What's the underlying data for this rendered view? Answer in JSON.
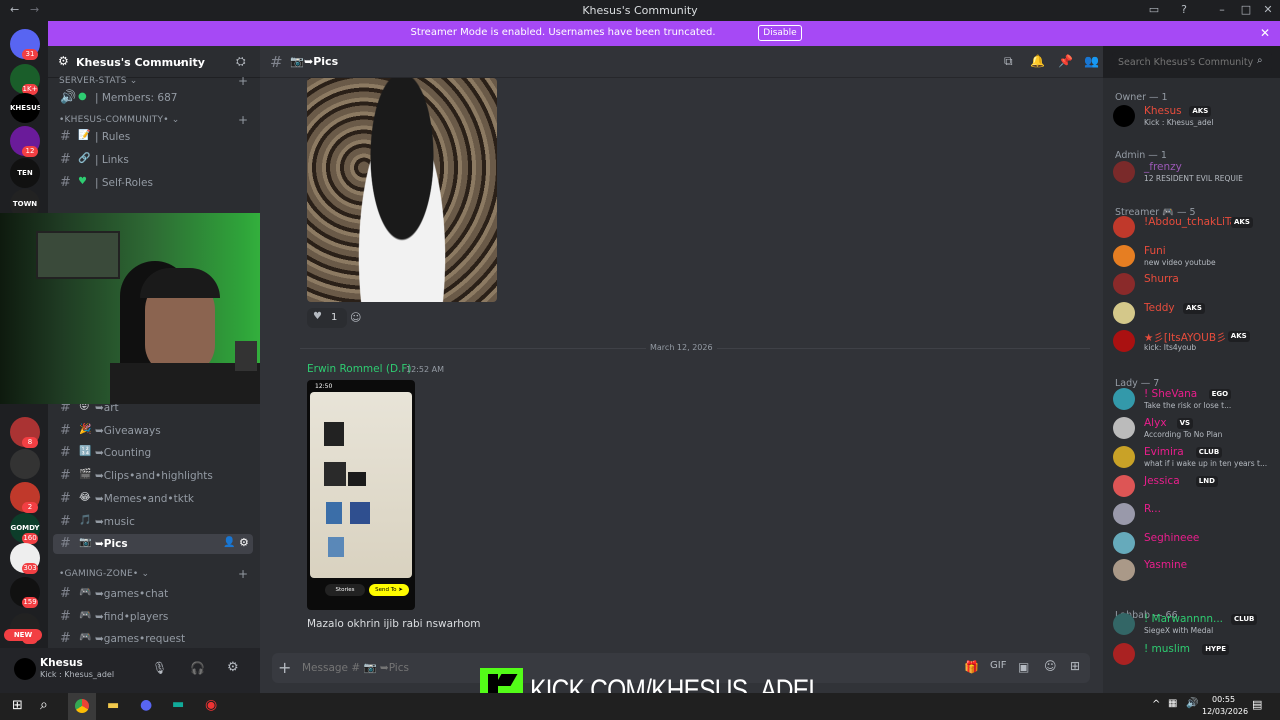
{
  "window": {
    "title": "Khesus's Community"
  },
  "banner": {
    "message": "Streamer Mode is enabled. Usernames have been truncated.",
    "disable_label": "Disable"
  },
  "server_list": [
    {
      "label": "",
      "badge": "31"
    },
    {
      "label": "",
      "badge": "1K+"
    },
    {
      "label": "KHESUS",
      "badge": ""
    },
    {
      "label": "",
      "badge": "12"
    },
    {
      "label": "TEN",
      "badge": ""
    },
    {
      "label": "TOWN",
      "badge": ""
    },
    {
      "label": "",
      "badge": "8"
    },
    {
      "label": "",
      "badge": ""
    },
    {
      "label": "",
      "badge": "2"
    },
    {
      "label": "GOMDY",
      "badge": "160"
    },
    {
      "label": "",
      "badge": "303"
    },
    {
      "label": "",
      "badge": "159"
    },
    {
      "label": "",
      "badge": "224"
    }
  ],
  "new_badge": "NEW",
  "sidebar": {
    "server_name": "Khesus's Community",
    "categories": [
      {
        "name": "SERVER-STATS ⌄",
        "channels": [
          {
            "label": "| Members: 687",
            "icon": "speaker-icon"
          }
        ]
      },
      {
        "name": "•KHESUS-COMMUNITY• ⌄",
        "channels": [
          {
            "label": "| Rules",
            "icon": "rules-icon"
          },
          {
            "label": "| Links",
            "icon": "link-icon"
          },
          {
            "label": "| Self-Roles",
            "icon": "heart-icon"
          }
        ]
      }
    ],
    "channels_lower": [
      {
        "label": "➥art"
      },
      {
        "label": "➥Giveaways"
      },
      {
        "label": "➥Counting"
      },
      {
        "label": "➥Clips•and•highlights"
      },
      {
        "label": "➥Memes•and•tktk"
      },
      {
        "label": "➥music"
      },
      {
        "label": "➥Pics",
        "active": true
      }
    ],
    "gaming": {
      "name": "•GAMING-ZONE• ⌄",
      "channels": [
        {
          "label": "➥games•chat"
        },
        {
          "label": "➥find•players"
        },
        {
          "label": "➥games•request"
        }
      ]
    }
  },
  "user": {
    "name": "Khesus",
    "status": "Kick : Khesus_adel"
  },
  "channel": {
    "name": "➥Pics",
    "header_hash": "#"
  },
  "search": {
    "placeholder": "Search Khesus's Community"
  },
  "messages": {
    "reaction_count": "1",
    "date_divider": "March 12, 2026",
    "author": "Erwin Rommel  (D.F)",
    "time": "12:52 AM",
    "text": "Mazalo okhrin ijib rabi nswarhom",
    "phone_labels": {
      "stories": "Stories",
      "send": "Send To ➤",
      "time": "12:50"
    }
  },
  "composer": {
    "placeholder": "Message # 📷 ➥Pics"
  },
  "members": {
    "groups": [
      {
        "title": "Owner — 1",
        "items": [
          {
            "name": "Khesus",
            "tag": "AKS",
            "status": "Kick : Khesus_adel",
            "color": "#e74c3c"
          }
        ]
      },
      {
        "title": "Admin — 1",
        "items": [
          {
            "name": "_frenzy",
            "tag": "",
            "status": "12 RESIDENT EVIL REQUIE",
            "color": "#9b59b6"
          }
        ]
      },
      {
        "title": "Streamer 🎮 — 5",
        "items": [
          {
            "name": "!Abdou_tchakLiTa",
            "tag": "AKS",
            "status": "",
            "color": "#e74c3c"
          },
          {
            "name": "Funi",
            "tag": "",
            "status": "new video youtube",
            "color": "#e74c3c"
          },
          {
            "name": "Shurra",
            "tag": "",
            "status": "",
            "color": "#e74c3c"
          },
          {
            "name": "Teddy",
            "tag": "AKS",
            "status": "",
            "color": "#e74c3c"
          },
          {
            "name": "★彡[ItsAYOUB彡",
            "tag": "AKS",
            "status": "kick: Its4youb",
            "color": "#e74c3c"
          }
        ]
      },
      {
        "title": "Lady — 7",
        "items": [
          {
            "name": "! SheVana",
            "tag": "EGO",
            "status": "Take the risk or lose t...",
            "color": "#e91e8c"
          },
          {
            "name": "Alyx",
            "tag": "VS",
            "status": "According To No Plan",
            "color": "#e91e8c"
          },
          {
            "name": "Evimira",
            "tag": "CLUB",
            "status": "what if i wake up in ten years t...",
            "color": "#e91e8c"
          },
          {
            "name": "Jessica",
            "tag": "LND",
            "status": "",
            "color": "#e91e8c"
          },
          {
            "name": "R...",
            "tag": "",
            "status": "",
            "color": "#e91e8c"
          },
          {
            "name": "Seghineee",
            "tag": "",
            "status": "",
            "color": "#e91e8c"
          },
          {
            "name": "Yasmine",
            "tag": "",
            "status": "",
            "color": "#e91e8c"
          }
        ]
      },
      {
        "title": "Lahbab — 66",
        "items": [
          {
            "name": "! Marwannnn...",
            "tag": "CLUB",
            "status": "SiegeX with Medal",
            "color": "#2ecc71"
          },
          {
            "name": "! muslim",
            "tag": "HYPE",
            "status": "",
            "color": "#2ecc71"
          }
        ]
      }
    ]
  },
  "overlay": {
    "kick_url": "KICK.COM/KHESUS_ADEL"
  },
  "taskbar": {
    "time": "00:55",
    "date": "12/03/2026"
  },
  "colors": {
    "accent": "#a649f5",
    "kick": "#53fc18"
  }
}
